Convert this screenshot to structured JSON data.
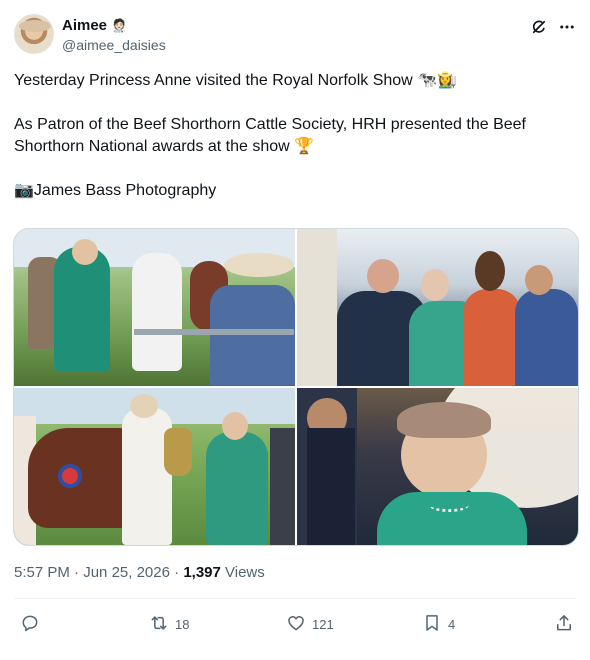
{
  "author": {
    "display_name": "Aimee",
    "name_emoji": "🧑🏻‍⚕️",
    "handle": "@aimee_daisies"
  },
  "tweet": {
    "line1": "Yesterday Princess Anne visited the Royal Norfolk Show 🐄👩‍🌾",
    "line2": "As Patron of the Beef Shorthorn Cattle Society, HRH presented the Beef Shorthorn National awards at the show 🏆",
    "line3": "📷James Bass Photography"
  },
  "media": {
    "photos": [
      {
        "description": "princess-anne-meeting-handlers"
      },
      {
        "description": "princess-anne-seated-in-stand"
      },
      {
        "description": "princess-anne-presenting-trophy-with-cow"
      },
      {
        "description": "princess-anne-smiling-with-parasol"
      }
    ]
  },
  "meta": {
    "time": "5:57 PM",
    "separator": " · ",
    "date": "Jun 25, 2026",
    "views_count": "1,397",
    "views_label": " Views"
  },
  "actions": {
    "reply_count": "",
    "retweet_count": "18",
    "like_count": "121",
    "bookmark_count": "4"
  },
  "icons": {
    "grok": "grok-icon",
    "more": "more-icon",
    "reply": "reply-icon",
    "retweet": "retweet-icon",
    "like": "heart-icon",
    "bookmark": "bookmark-icon",
    "share": "share-icon"
  },
  "colors": {
    "text": "#0f1419",
    "secondary": "#536471",
    "border": "#cfd9de"
  }
}
